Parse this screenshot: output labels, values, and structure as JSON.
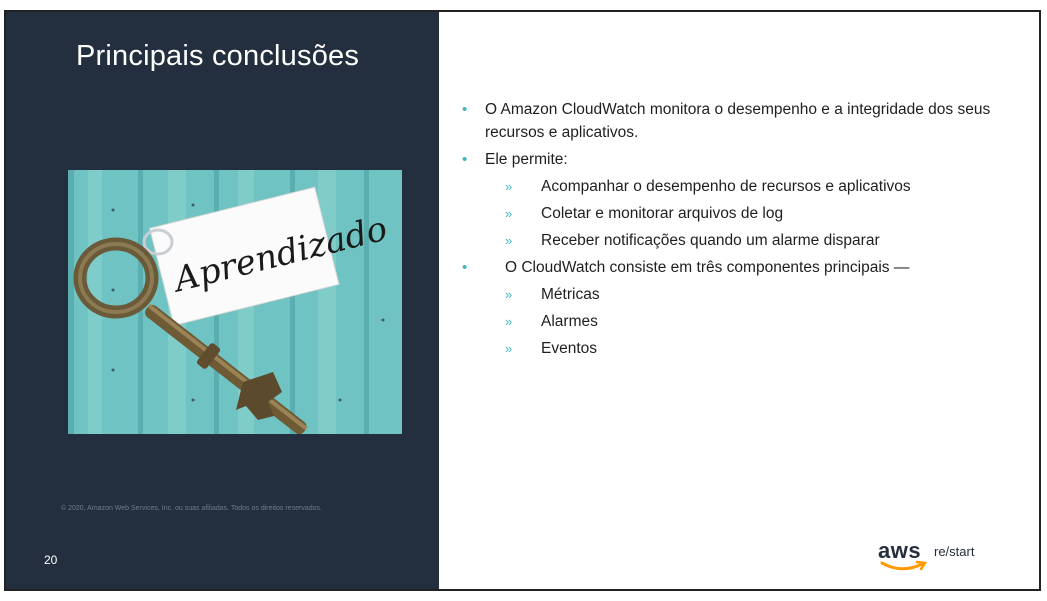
{
  "slide": {
    "title": "Principais conclusões",
    "image_tag_text": "Aprendizado",
    "copyright": "© 2020, Amazon Web Services, Inc. ou suas afiliadas. Todos os direitos reservados.",
    "page_number": "20",
    "bullets": [
      {
        "text": "O Amazon CloudWatch monitora o desempenho e a integridade dos seus recursos e aplicativos."
      },
      {
        "text": "Ele permite:"
      },
      {
        "text": "Acompanhar o desempenho de recursos e aplicativos"
      },
      {
        "text": "Coletar e monitorar arquivos de log"
      },
      {
        "text": "Receber notificações quando um alarme disparar"
      },
      {
        "text": "O CloudWatch consiste em três componentes principais —"
      },
      {
        "text": "Métricas"
      },
      {
        "text": "Alarmes"
      },
      {
        "text": "Eventos"
      }
    ],
    "bullet_symbol": "•",
    "sub_bullet_symbol": "»",
    "logo": {
      "brand": "aws",
      "suffix": "re/start"
    }
  },
  "colors": {
    "panel": "#232f3e",
    "accent": "#3fb7c2",
    "aws_orange": "#ff9900"
  }
}
